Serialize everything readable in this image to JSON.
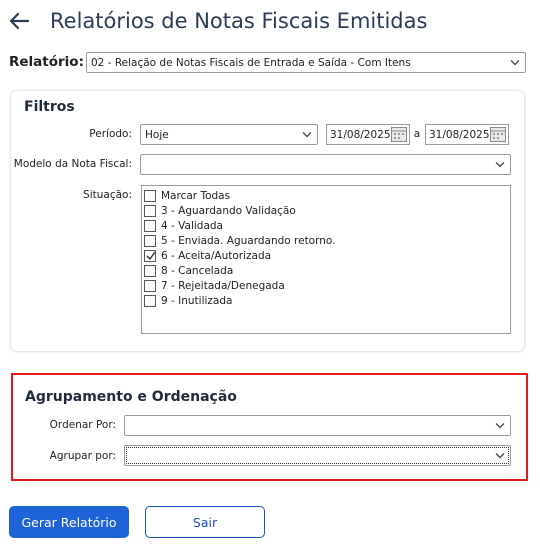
{
  "header": {
    "title": "Relatórios de Notas Fiscais Emitidas"
  },
  "report": {
    "label": "Relatório:",
    "selected": "02 - Relação de Notas Fiscais de Entrada e Saída - Com Itens"
  },
  "filters": {
    "title": "Filtros",
    "period": {
      "label": "Período:",
      "selected": "Hoje",
      "date_from": "31/08/2025",
      "separator": "a",
      "date_to": "31/08/2025"
    },
    "model": {
      "label": "Modelo da Nota Fiscal:",
      "selected": ""
    },
    "status": {
      "label": "Situação:",
      "options": [
        {
          "label": "Marcar Todas",
          "checked": false
        },
        {
          "label": "3 - Aguardando Validação",
          "checked": false
        },
        {
          "label": "4 - Validada",
          "checked": false
        },
        {
          "label": "5 - Enviada. Aguardando retorno.",
          "checked": false
        },
        {
          "label": "6 - Aceita/Autorizada",
          "checked": true
        },
        {
          "label": "8 - Cancelada",
          "checked": false
        },
        {
          "label": "7 - Rejeitada/Denegada",
          "checked": false
        },
        {
          "label": "9 - Inutilizada",
          "checked": false
        }
      ]
    }
  },
  "grouping": {
    "title": "Agrupamento e Ordenação",
    "order_label": "Ordenar Por:",
    "order_selected": "",
    "group_label": "Agrupar por:",
    "group_selected": ""
  },
  "actions": {
    "generate_label": "Gerar Relatório",
    "exit_label": "Sair"
  },
  "colors": {
    "title": "#2b3a55",
    "primary_button": "#1f63d8",
    "highlight_border": "#e01b1b"
  }
}
